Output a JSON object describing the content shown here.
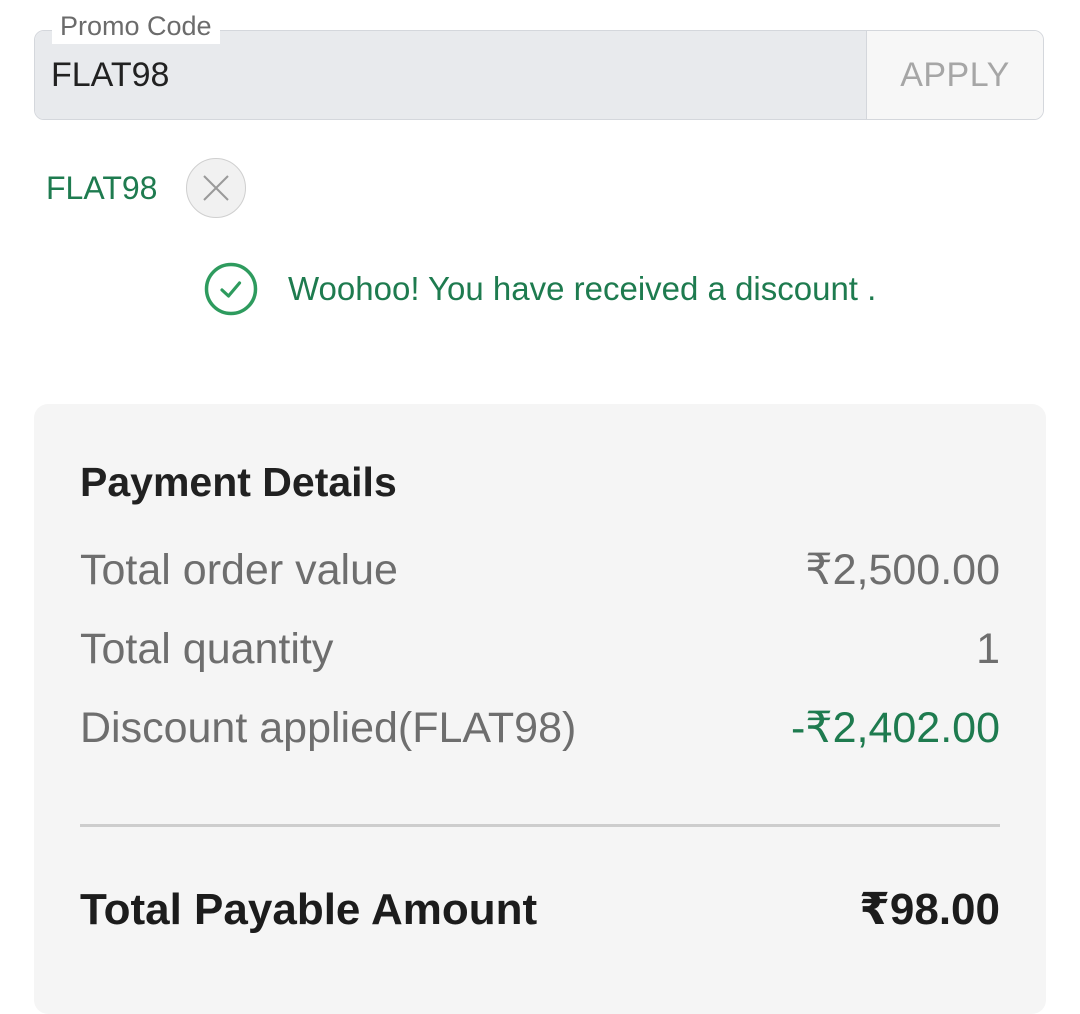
{
  "promo": {
    "label": "Promo Code",
    "value": "FLAT98",
    "apply_label": "APPLY"
  },
  "applied": {
    "code": "FLAT98",
    "remove_icon": "close-icon"
  },
  "success": {
    "icon": "check-circle-icon",
    "message": "Woohoo! You have received a discount ."
  },
  "payment": {
    "title": "Payment Details",
    "rows": [
      {
        "label": "Total order value",
        "value": "₹2,500.00"
      },
      {
        "label": "Total quantity",
        "value": "1"
      },
      {
        "label": "Discount applied(FLAT98)",
        "value": "-₹2,402.00"
      }
    ],
    "total": {
      "label": "Total Payable Amount",
      "value": "₹98.00"
    }
  },
  "colors": {
    "accent_green": "#1e7b4f",
    "card_background": "#f5f5f5",
    "input_background": "#e8eaed",
    "muted_text": "#6e6e6e"
  }
}
